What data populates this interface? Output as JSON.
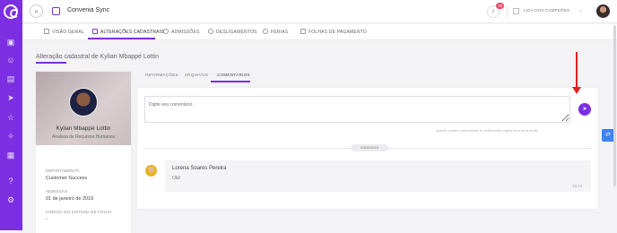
{
  "app": {
    "title": "Convenia Sync"
  },
  "notifications": {
    "count": "78"
  },
  "company": {
    "name": "LIGA DOS CAMPEÕES"
  },
  "tabs": [
    {
      "label": "VISÃO GERAL"
    },
    {
      "label": "ALTERAÇÕES CADASTRAIS"
    },
    {
      "label": "ADMISSÕES"
    },
    {
      "label": "DESLIGAMENTOS"
    },
    {
      "label": "FÉRIAS"
    },
    {
      "label": "FOLHAS DE PAGAMENTO"
    }
  ],
  "page": {
    "title": "Alteração cadastral de Kylian Mbappé Lottin"
  },
  "profile": {
    "name": "Kylian Mbappé Lottin",
    "role": "Analista de Recursos Humanos",
    "fields": [
      {
        "label": "DEPARTAMENTO",
        "value": "Customer Success"
      },
      {
        "label": "ADMISSÃO",
        "value": "01 de janeiro de 2019"
      },
      {
        "label": "CÓDIGO DO SISTEMA DE FOLHA",
        "value": "-"
      }
    ]
  },
  "subtabs": [
    {
      "label": "INFORMAÇÕES"
    },
    {
      "label": "ARQUIVOS"
    },
    {
      "label": "COMENTÁRIOS"
    }
  ],
  "comments": {
    "placeholder": "Digite seu comentário",
    "hint": "Aperte <enter> para enviar e <shift+enter> para uma nova linha.",
    "date": "03/02/2023",
    "items": [
      {
        "author": "Lorena Soares Pereira",
        "text": "Olá!",
        "time": "15:22"
      }
    ]
  },
  "colors": {
    "accent": "#7b2fe0",
    "arrow": "#e02020"
  }
}
